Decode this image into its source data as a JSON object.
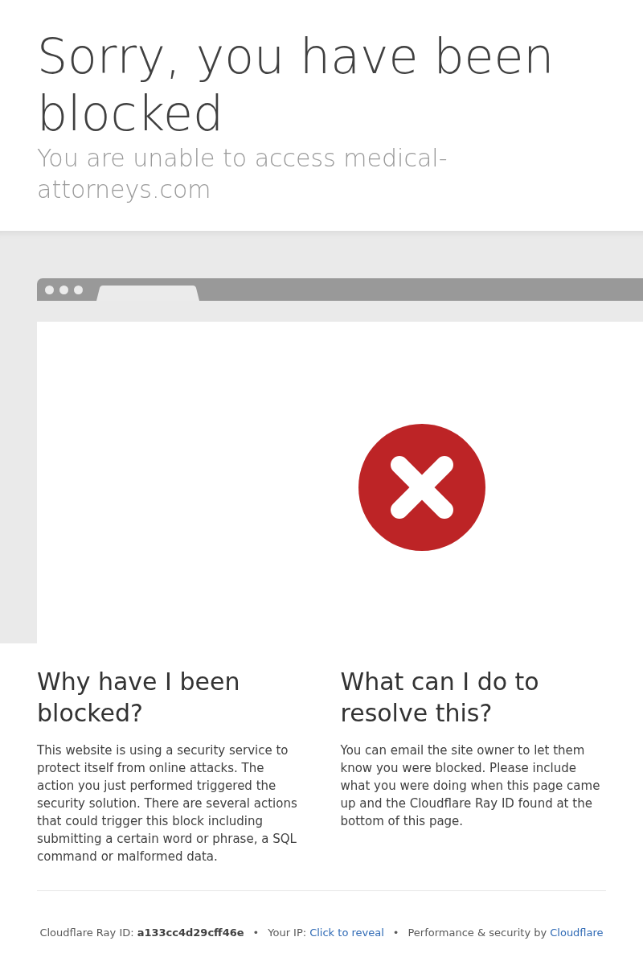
{
  "title": "Sorry, you have been blocked",
  "subtitle": "You are unable to access medical-attorneys.com",
  "sections": [
    {
      "heading": "Why have I been blocked?",
      "body": "This website is using a security service to protect itself from online attacks. The action you just performed triggered the security solution. There are several actions that could trigger this block including submitting a certain word or phrase, a SQL command or malformed data."
    },
    {
      "heading": "What can I do to resolve this?",
      "body": "You can email the site owner to let them know you were blocked. Please include what you were doing when this page came up and the Cloudflare Ray ID found at the bottom of this page."
    }
  ],
  "footer": [
    {
      "kind": "bold",
      "label": "Cloudflare Ray ID:",
      "value": "a133cc4d29cff46e"
    },
    {
      "kind": "separator",
      "text": "•"
    },
    {
      "kind": "link",
      "label": "Your IP:",
      "link": "Click to reveal"
    },
    {
      "kind": "separator",
      "text": "•"
    },
    {
      "kind": "link",
      "label": "Performance & security by",
      "link": "Cloudflare"
    }
  ]
}
